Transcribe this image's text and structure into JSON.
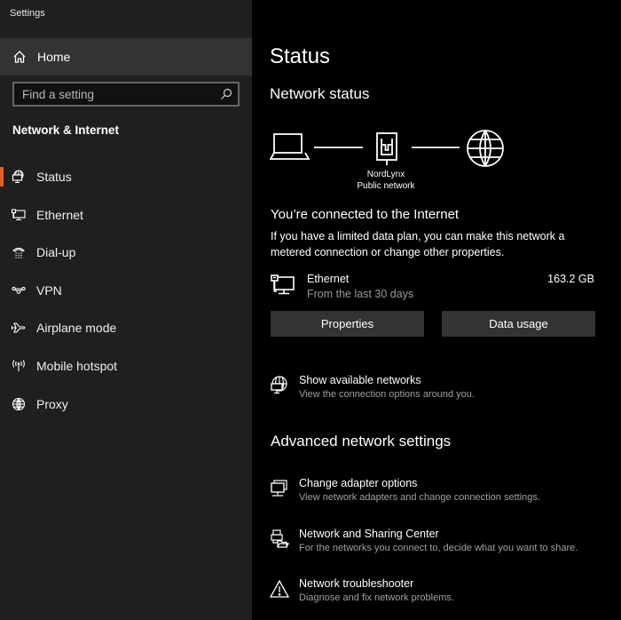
{
  "app": {
    "title": "Settings"
  },
  "sidebar": {
    "home_label": "Home",
    "search": {
      "placeholder": "Find a setting",
      "value": ""
    },
    "section_title": "Network & Internet",
    "accent_color": "#e25f21",
    "items": [
      {
        "label": "Status",
        "icon": "status-icon",
        "selected": true
      },
      {
        "label": "Ethernet",
        "icon": "ethernet-icon",
        "selected": false
      },
      {
        "label": "Dial-up",
        "icon": "dialup-icon",
        "selected": false
      },
      {
        "label": "VPN",
        "icon": "vpn-icon",
        "selected": false
      },
      {
        "label": "Airplane mode",
        "icon": "airplane-icon",
        "selected": false
      },
      {
        "label": "Mobile hotspot",
        "icon": "hotspot-icon",
        "selected": false
      },
      {
        "label": "Proxy",
        "icon": "globe-icon",
        "selected": false
      }
    ]
  },
  "main": {
    "title": "Status",
    "network_status_heading": "Network status",
    "diagram": {
      "network_name": "NordLynx",
      "network_type": "Public network"
    },
    "connection_title": "You’re connected to the Internet",
    "connection_desc": "If you have a limited data plan, you can make this network a metered connection or change other properties.",
    "usage": {
      "adapter": "Ethernet",
      "period": "From the last 30 days",
      "amount": "163.2 GB"
    },
    "buttons": {
      "properties": "Properties",
      "data_usage": "Data usage"
    },
    "show_networks": {
      "title": "Show available networks",
      "desc": "View the connection options around you."
    },
    "advanced_heading": "Advanced network settings",
    "advanced_items": [
      {
        "title": "Change adapter options",
        "desc": "View network adapters and change connection settings."
      },
      {
        "title": "Network and Sharing Center",
        "desc": "For the networks you connect to, decide what you want to share."
      },
      {
        "title": "Network troubleshooter",
        "desc": "Diagnose and fix network problems."
      }
    ]
  }
}
